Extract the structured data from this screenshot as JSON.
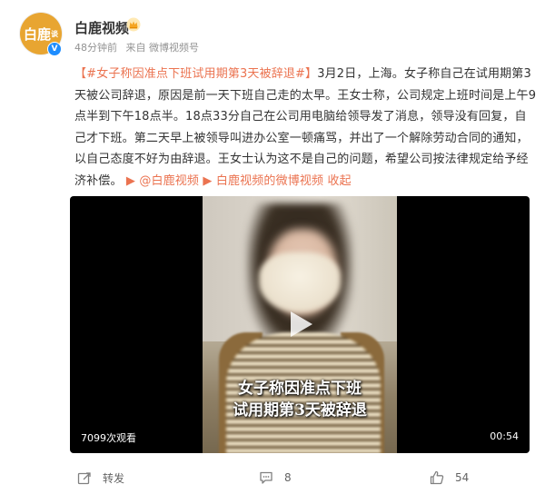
{
  "post": {
    "author": "白鹿视频",
    "avatar_text": "白鹿",
    "avatar_sup": "谈",
    "verified_icon": "v-badge-icon",
    "member_icon": "crown-icon",
    "time": "48分钟前",
    "source": "来自 微博视频号",
    "topic": "【#女子称因准点下班试用期第3天被辞退#】",
    "body_text": "3月2日，上海。女子称自己在试用期第3天被公司辞退，原因是前一天下班自己走的太早。王女士称，公司规定上班时间是上午9点半到下午18点半。18点33分自己在公司用电脑给领导发了消息，领导没有回复，自己才下班。第二天早上被领导叫进办公室一顿痛骂，并出了一个解除劳动合同的通知，以自己态度不好为由辞退。王女士认为这不是自己的问题，希望公司按法律规定给予经济补偿。",
    "link_1": "@白鹿视频",
    "link_2": "白鹿视频的微博视频",
    "collapse": "收起"
  },
  "video": {
    "caption_line1": "女子称因准点下班",
    "caption_line2": "试用期第3天被辞退",
    "views": "7099次观看",
    "duration": "00:54"
  },
  "actions": {
    "repost_label": "转发",
    "comment_count": "8",
    "like_count": "54"
  },
  "colors": {
    "link": "#eb7350",
    "text": "#333333",
    "meta": "#939393"
  }
}
